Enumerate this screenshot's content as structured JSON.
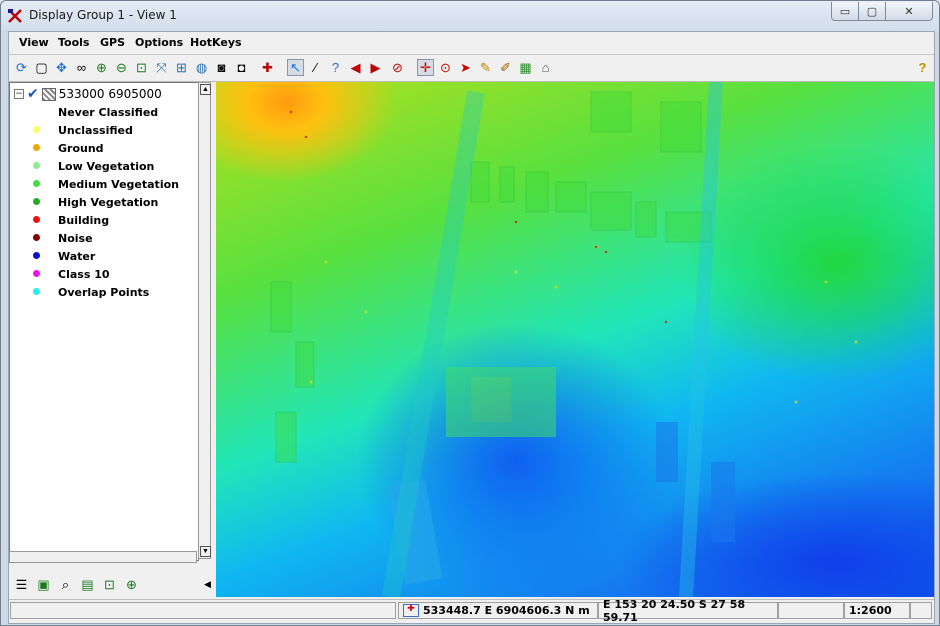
{
  "window": {
    "title": "Display Group 1 - View 1",
    "min": "▭",
    "max": "▢",
    "close": "✕"
  },
  "menu": [
    "View",
    "Tools",
    "GPS",
    "Options",
    "HotKeys"
  ],
  "icons": {
    "app": "app-x-icon",
    "toolbar": [
      "redraw-icon",
      "extents-icon",
      "pan-icon",
      "binoculars-icon",
      "zoom-in-icon",
      "zoom-out-icon",
      "zoom-box-icon",
      "full-view-icon",
      "multi-view-icon",
      "globe-icon",
      "camera-icon",
      "add-layer-icon",
      "select-icon",
      "measure-icon",
      "help-pointer-icon",
      "back-icon",
      "forward-icon",
      "stop-icon",
      "move-icon",
      "zoom-target-icon",
      "pointer-icon",
      "sketch-icon",
      "edit-icon",
      "histogram-icon",
      "gps-icon",
      "help-icon"
    ],
    "legend_toolbar": [
      "legend-icon",
      "layer-icon",
      "search-icon",
      "map-icon",
      "zoom-box-icon",
      "zoom-in-icon"
    ]
  },
  "legend": {
    "root_label": "533000 6905000",
    "categories": [
      {
        "label": "Never Classified",
        "color": "#ffffff"
      },
      {
        "label": "Unclassified",
        "color": "#ffff66"
      },
      {
        "label": "Ground",
        "color": "#f4a400"
      },
      {
        "label": "Low Vegetation",
        "color": "#88f088"
      },
      {
        "label": "Medium Vegetation",
        "color": "#44dd44"
      },
      {
        "label": "High Vegetation",
        "color": "#22aa22"
      },
      {
        "label": "Building",
        "color": "#ee1010"
      },
      {
        "label": "Noise",
        "color": "#880000"
      },
      {
        "label": "Water",
        "color": "#1010cc"
      },
      {
        "label": "Class 10",
        "color": "#ee10ee"
      },
      {
        "label": "Overlap Points",
        "color": "#22eeee"
      }
    ]
  },
  "status": {
    "coords": "533448.7 E  6904606.3 N m",
    "latlon": "E 153 20 24.50  S 27 58 59.71",
    "scale": "1:2600"
  }
}
